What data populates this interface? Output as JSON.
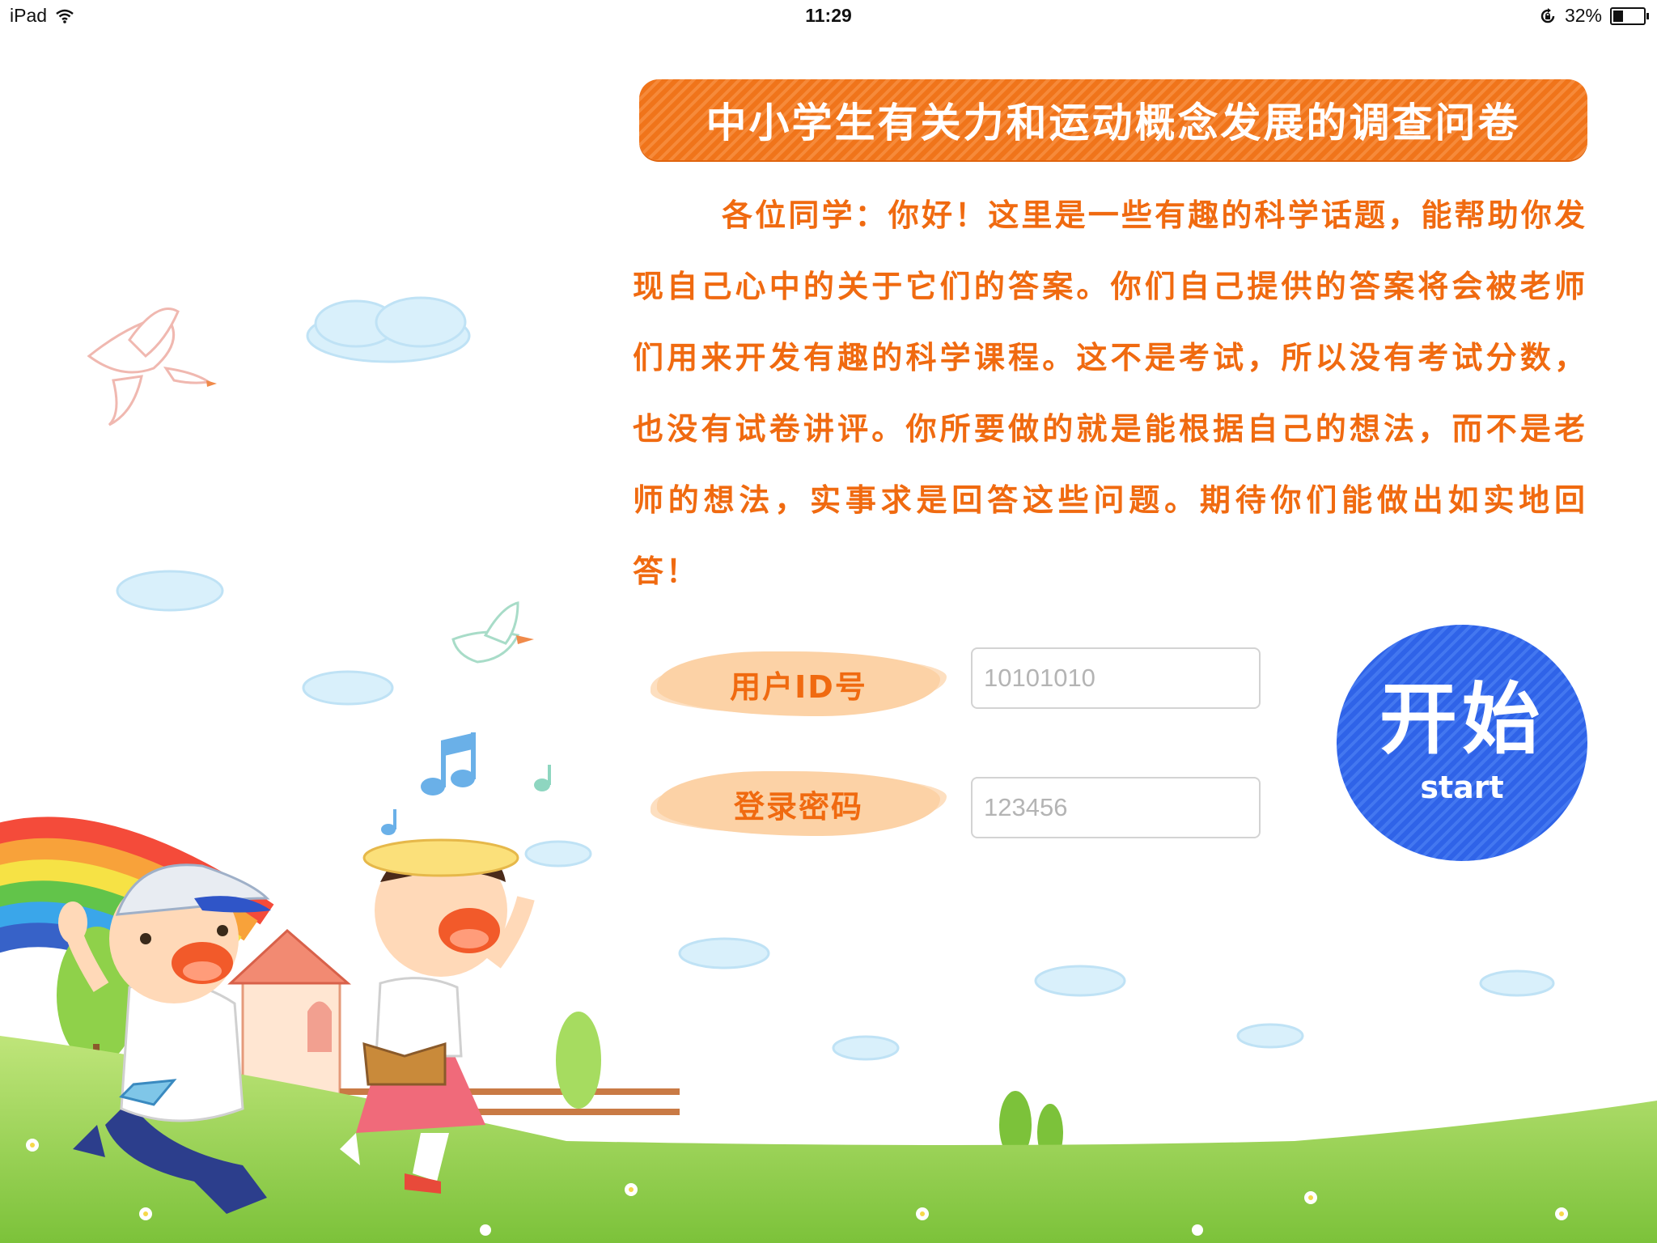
{
  "status_bar": {
    "device": "iPad",
    "time": "11:29",
    "battery_percent_label": "32%",
    "battery_level": 0.32
  },
  "header": {
    "title": "中小学生有关力和运动概念发展的调查问卷"
  },
  "intro": {
    "text": "各位同学：你好！这里是一些有趣的科学话题，能帮助你发现自己心中的关于它们的答案。你们自己提供的答案将会被老师们用来开发有趣的科学课程。这不是考试，所以没有考试分数，也没有试卷讲评。你所要做的就是能根据自己的想法，而不是老师的想法，实事求是回答这些问题。期待你们能做出如实地回答！"
  },
  "form": {
    "user_id_label": "用户ID号",
    "user_id_placeholder": "10101010",
    "password_label": "登录密码",
    "password_placeholder": "123456"
  },
  "start_button": {
    "label_cn": "开始",
    "label_en": "start"
  },
  "icons": {
    "wifi": "wifi-icon",
    "orientation_lock": "orientation-lock-icon",
    "battery": "battery-icon"
  },
  "colors": {
    "accent_orange": "#f06a10",
    "title_bg": "#f0741a",
    "start_blue": "#2f63e8",
    "label_bg": "#fcd2a6"
  }
}
